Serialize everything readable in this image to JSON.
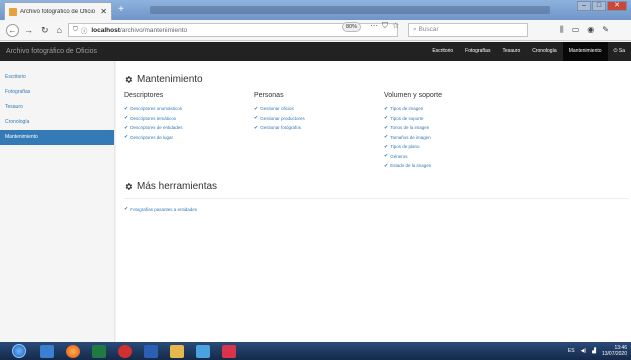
{
  "browser": {
    "tab_title": "Archivo fotográfico de Oficio",
    "url_host": "localhost",
    "url_path": "/archivo/mantenimiento",
    "zoom": "80%",
    "search_placeholder": "Buscar"
  },
  "site": {
    "brand": "Archivo fotográfico de Oficios",
    "nav": [
      "Escritorio",
      "Fotografías",
      "Tesauro",
      "Cronología",
      "Mantenimiento",
      "Sa"
    ]
  },
  "sidebar": {
    "items": [
      "Escritorio",
      "Fotografías",
      "Tesauro",
      "Cronología",
      "Mantenimiento"
    ]
  },
  "main": {
    "title": "Mantenimiento",
    "columns": [
      {
        "header": "Descriptores",
        "links": [
          "Descriptores onomásticos",
          "Descriptores temáticos",
          "Descriptores de entidades",
          "Descriptores de lugar"
        ]
      },
      {
        "header": "Personas",
        "links": [
          "Gestionar oficios",
          "Gestionar productores",
          "Gestionar fotógrafos"
        ]
      },
      {
        "header": "Volumen y soporte",
        "links": [
          "Tipos de imagen",
          "Tipos de soporte",
          "Tonos de la imagen",
          "Tamaños de imagen",
          "Tipos de plano",
          "Géneros",
          "Estado de la imagen"
        ]
      }
    ],
    "more_title": "Más herramientas",
    "more_links": [
      "Fotografías pasantes a entidades"
    ]
  },
  "taskbar": {
    "lang": "ES",
    "time": "13:46",
    "date": "13/07/2020"
  }
}
